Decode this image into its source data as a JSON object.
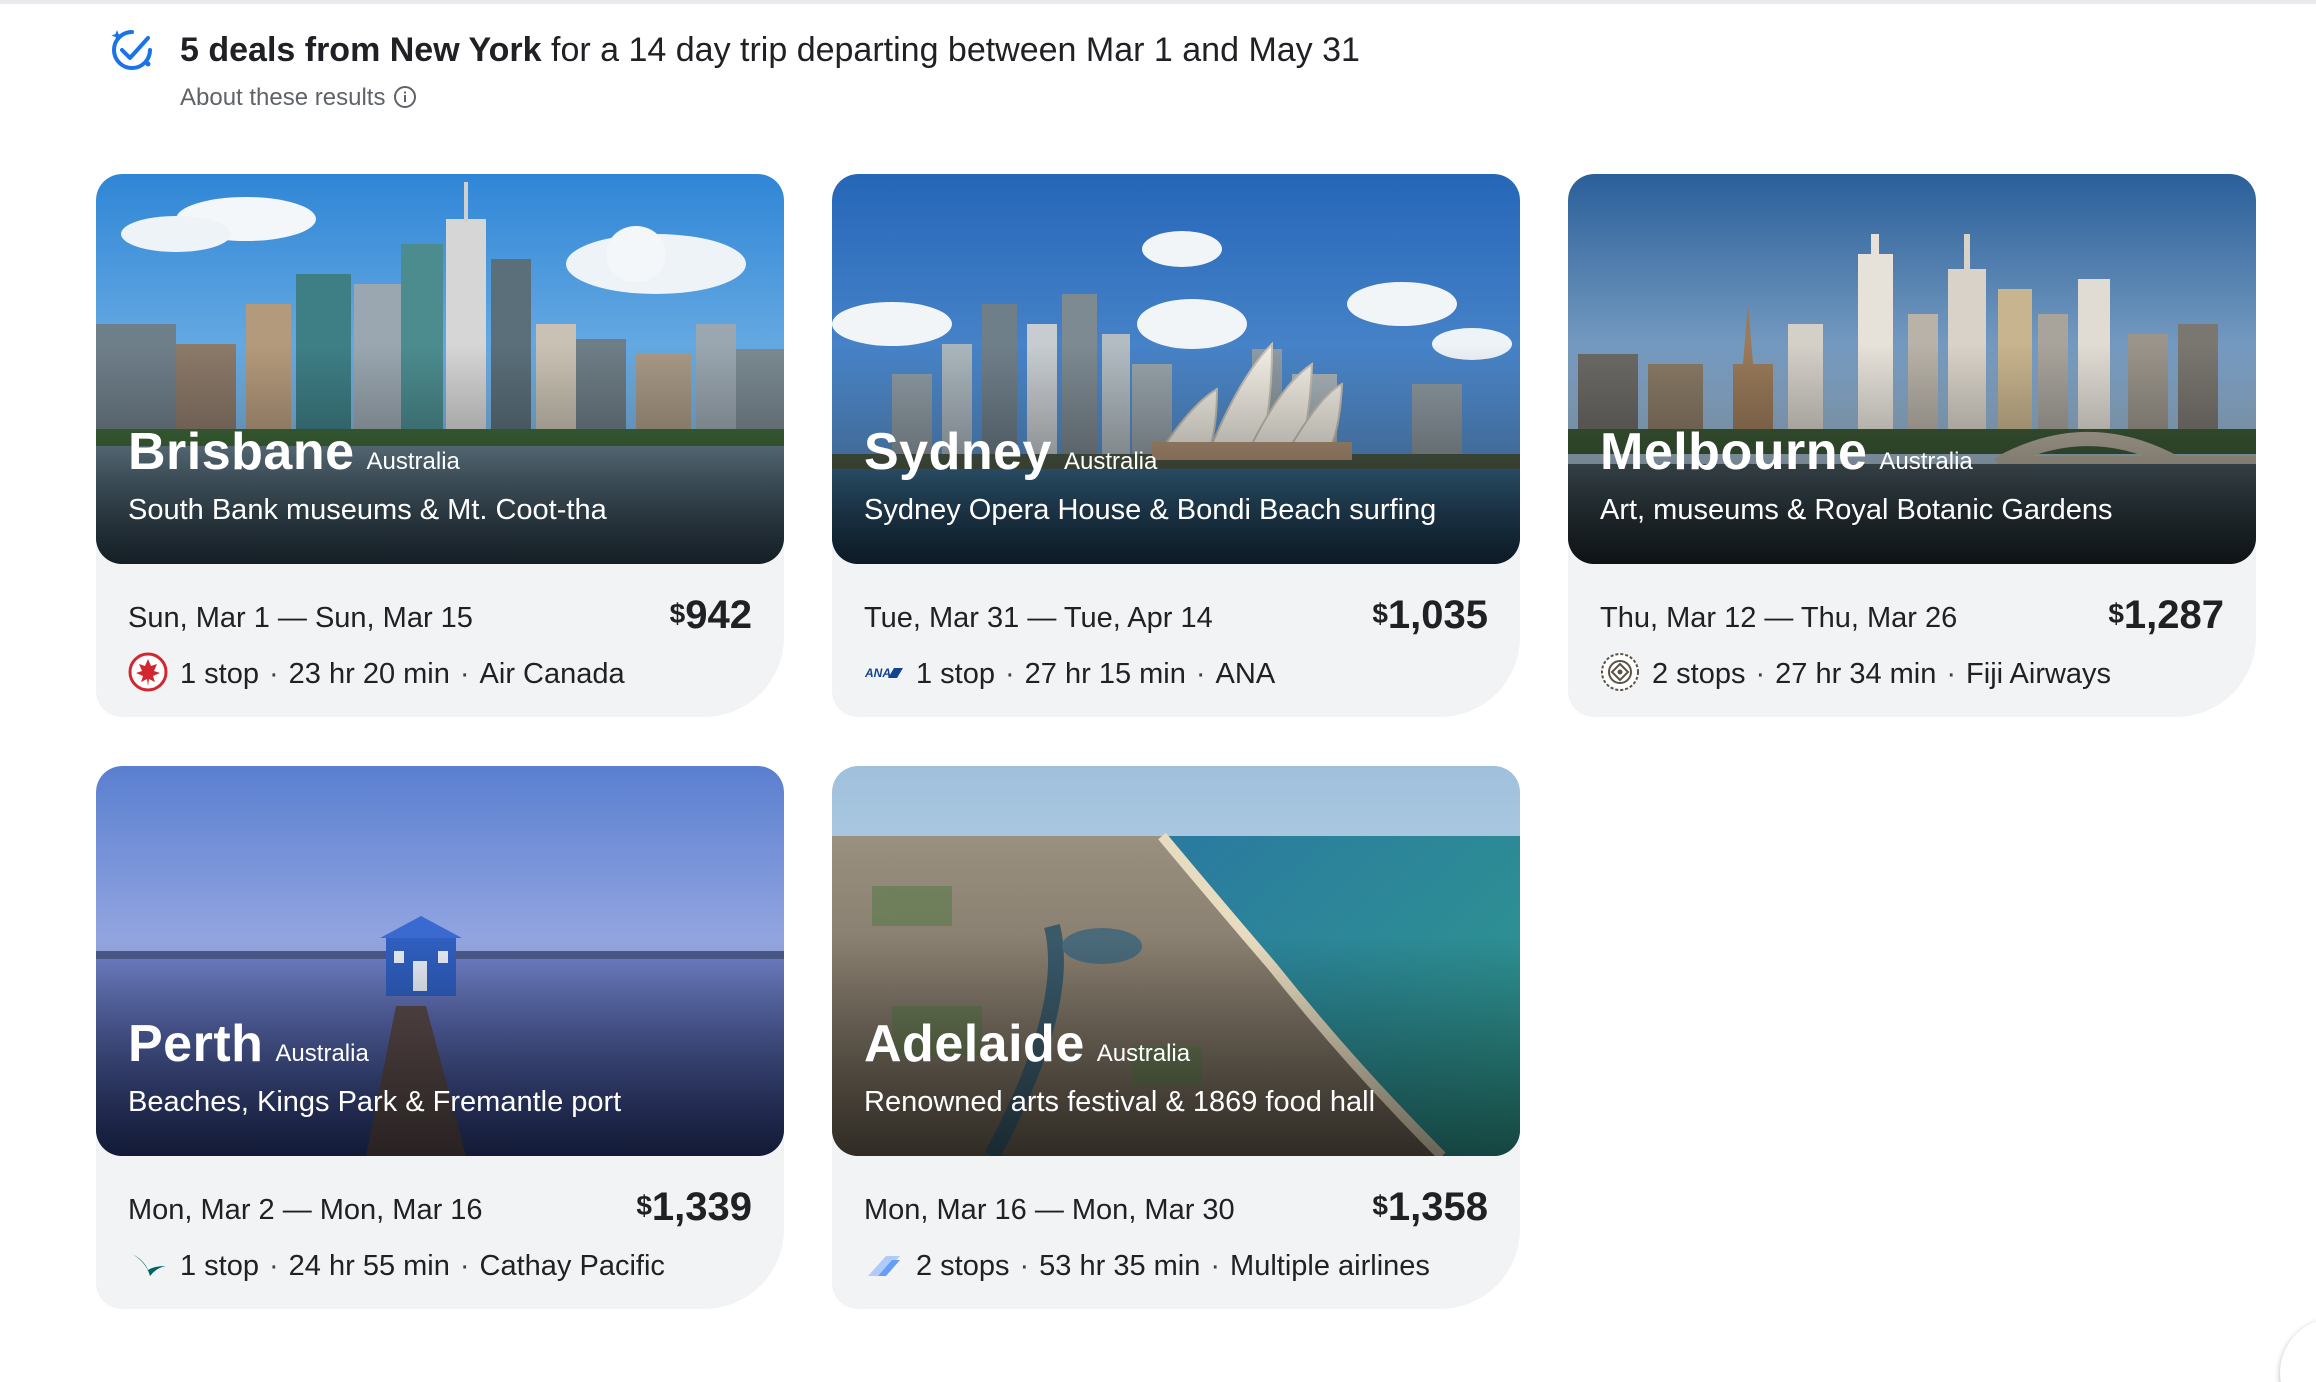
{
  "header": {
    "icon": "sparkle-check-icon",
    "headline_bold": "5 deals from New York",
    "headline_rest": " for a 14 day trip departing between Mar 1 and May 31",
    "about_label": "About these results",
    "about_icon": "info-icon"
  },
  "deals": [
    {
      "city": "Brisbane",
      "country": "Australia",
      "tagline": "South Bank museums & Mt. Coot-tha",
      "dates": "Sun, Mar 1 — Sun, Mar 15",
      "currency": "$",
      "price": "942",
      "stops": "1 stop",
      "duration": "23 hr 20 min",
      "airline": "Air Canada",
      "airline_icon": "air-canada-logo-icon"
    },
    {
      "city": "Sydney",
      "country": "Australia",
      "tagline": "Sydney Opera House & Bondi Beach surfing",
      "dates": "Tue, Mar 31 — Tue, Apr 14",
      "currency": "$",
      "price": "1,035",
      "stops": "1 stop",
      "duration": "27 hr 15 min",
      "airline": "ANA",
      "airline_icon": "ana-logo-icon",
      "airline_logo_text": "ANA"
    },
    {
      "city": "Melbourne",
      "country": "Australia",
      "tagline": "Art, museums & Royal Botanic Gardens",
      "dates": "Thu, Mar 12 — Thu, Mar 26",
      "currency": "$",
      "price": "1,287",
      "stops": "2 stops",
      "duration": "27 hr 34 min",
      "airline": "Fiji Airways",
      "airline_icon": "fiji-airways-logo-icon"
    },
    {
      "city": "Perth",
      "country": "Australia",
      "tagline": "Beaches, Kings Park & Fremantle port",
      "dates": "Mon, Mar 2 — Mon, Mar 16",
      "currency": "$",
      "price": "1,339",
      "stops": "1 stop",
      "duration": "24 hr 55 min",
      "airline": "Cathay Pacific",
      "airline_icon": "cathay-pacific-logo-icon"
    },
    {
      "city": "Adelaide",
      "country": "Australia",
      "tagline": "Renowned arts festival & 1869 food hall",
      "dates": "Mon, Mar 16 — Mon, Mar 30",
      "currency": "$",
      "price": "1,358",
      "stops": "2 stops",
      "duration": "53 hr 35 min",
      "airline": "Multiple airlines",
      "airline_icon": "multiple-airlines-icon"
    }
  ],
  "separator": "·",
  "colors": {
    "card_bg": "#f1f3f4",
    "text": "#202124",
    "secondary_text": "#5f6368",
    "accent_blue": "#1a73e8"
  }
}
